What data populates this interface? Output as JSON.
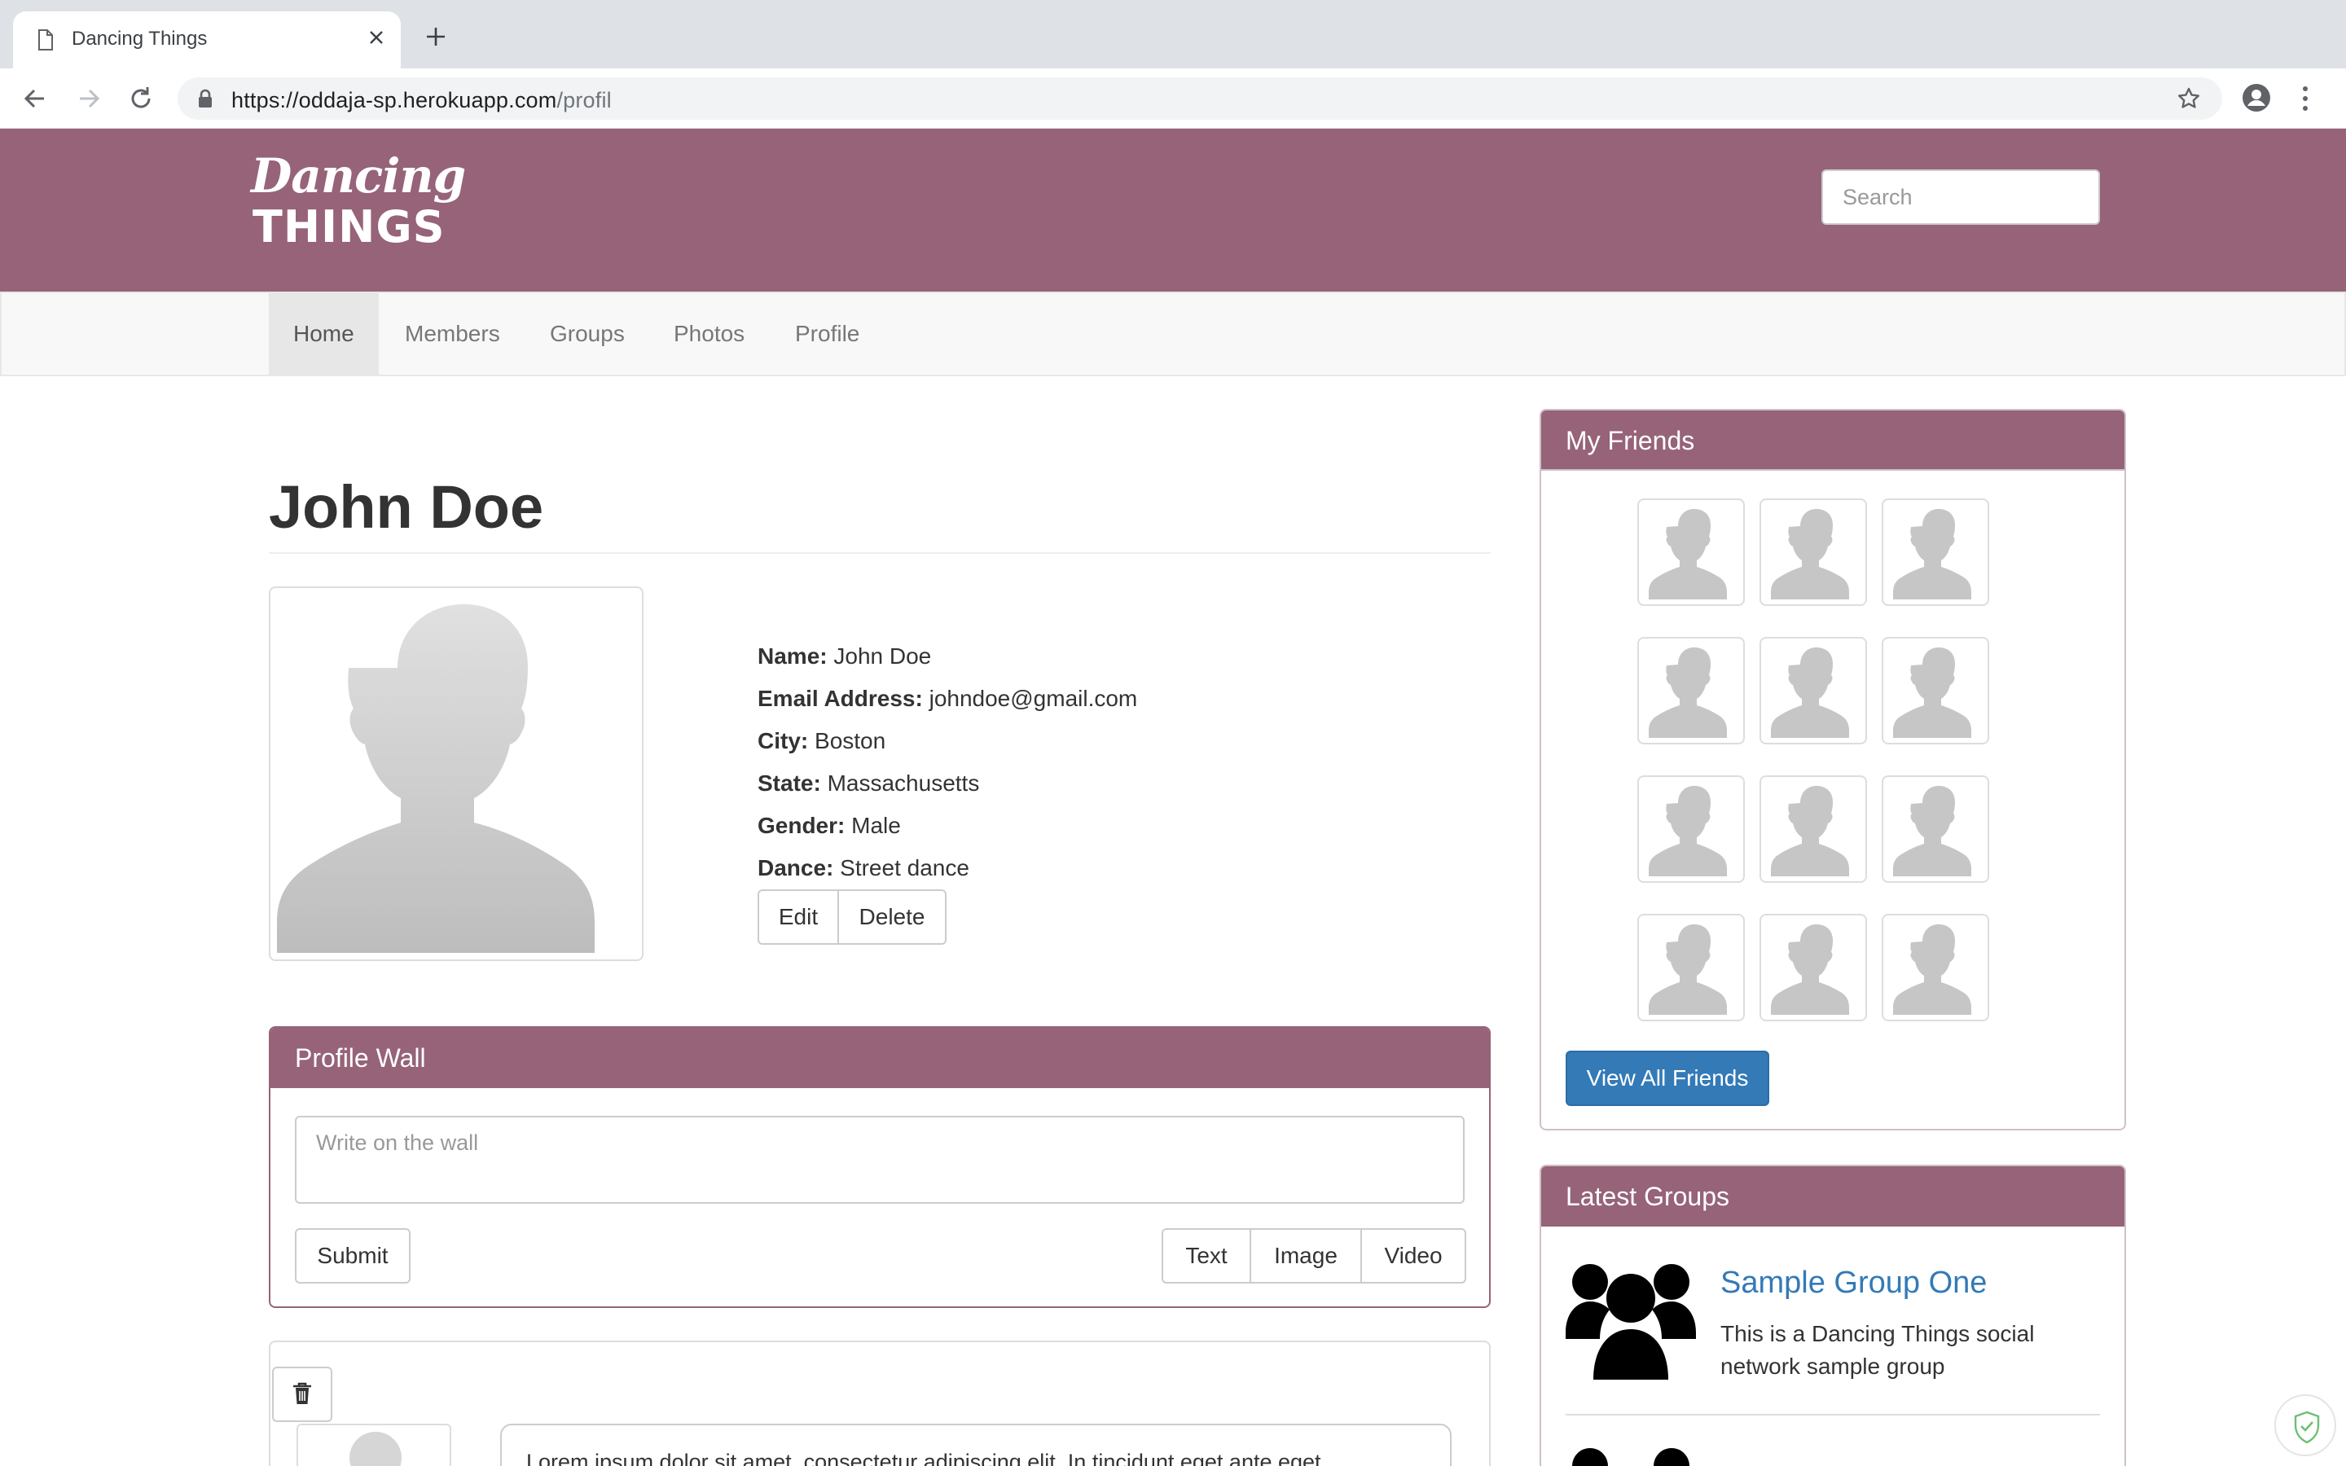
{
  "browser": {
    "tab_title": "Dancing Things",
    "url_host": "https://oddaja-sp.herokuapp.com",
    "url_path": "/profil"
  },
  "header": {
    "logo_line1": "Dancing",
    "logo_line2": "THINGS",
    "search_placeholder": "Search"
  },
  "nav": {
    "items": [
      {
        "label": "Home"
      },
      {
        "label": "Members"
      },
      {
        "label": "Groups"
      },
      {
        "label": "Photos"
      },
      {
        "label": "Profile"
      }
    ]
  },
  "profile": {
    "name": "John Doe",
    "fields": [
      {
        "label": "Name:",
        "value": "John Doe"
      },
      {
        "label": "Email Address:",
        "value": "johndoe@gmail.com"
      },
      {
        "label": "City:",
        "value": "Boston"
      },
      {
        "label": "State:",
        "value": "Massachusetts"
      },
      {
        "label": "Gender:",
        "value": "Male"
      },
      {
        "label": "Dance:",
        "value": "Street dance"
      }
    ],
    "edit_label": "Edit",
    "delete_label": "Delete"
  },
  "wall": {
    "heading": "Profile Wall",
    "placeholder": "Write on the wall",
    "submit_label": "Submit",
    "types": [
      {
        "label": "Text"
      },
      {
        "label": "Image"
      },
      {
        "label": "Video"
      }
    ],
    "post_text": "Lorem ipsum dolor sit amet, consectetur adipiscing elit. In tincidunt eget ante eget"
  },
  "friends": {
    "heading": "My Friends",
    "count": 12,
    "view_all_label": "View All Friends"
  },
  "groups": {
    "heading": "Latest Groups",
    "items": [
      {
        "title": "Sample Group One",
        "description": "This is a Dancing Things social network sample group"
      }
    ]
  },
  "colors": {
    "brand": "#966378",
    "link": "#337ab7",
    "primary_button": "#337ab7"
  }
}
